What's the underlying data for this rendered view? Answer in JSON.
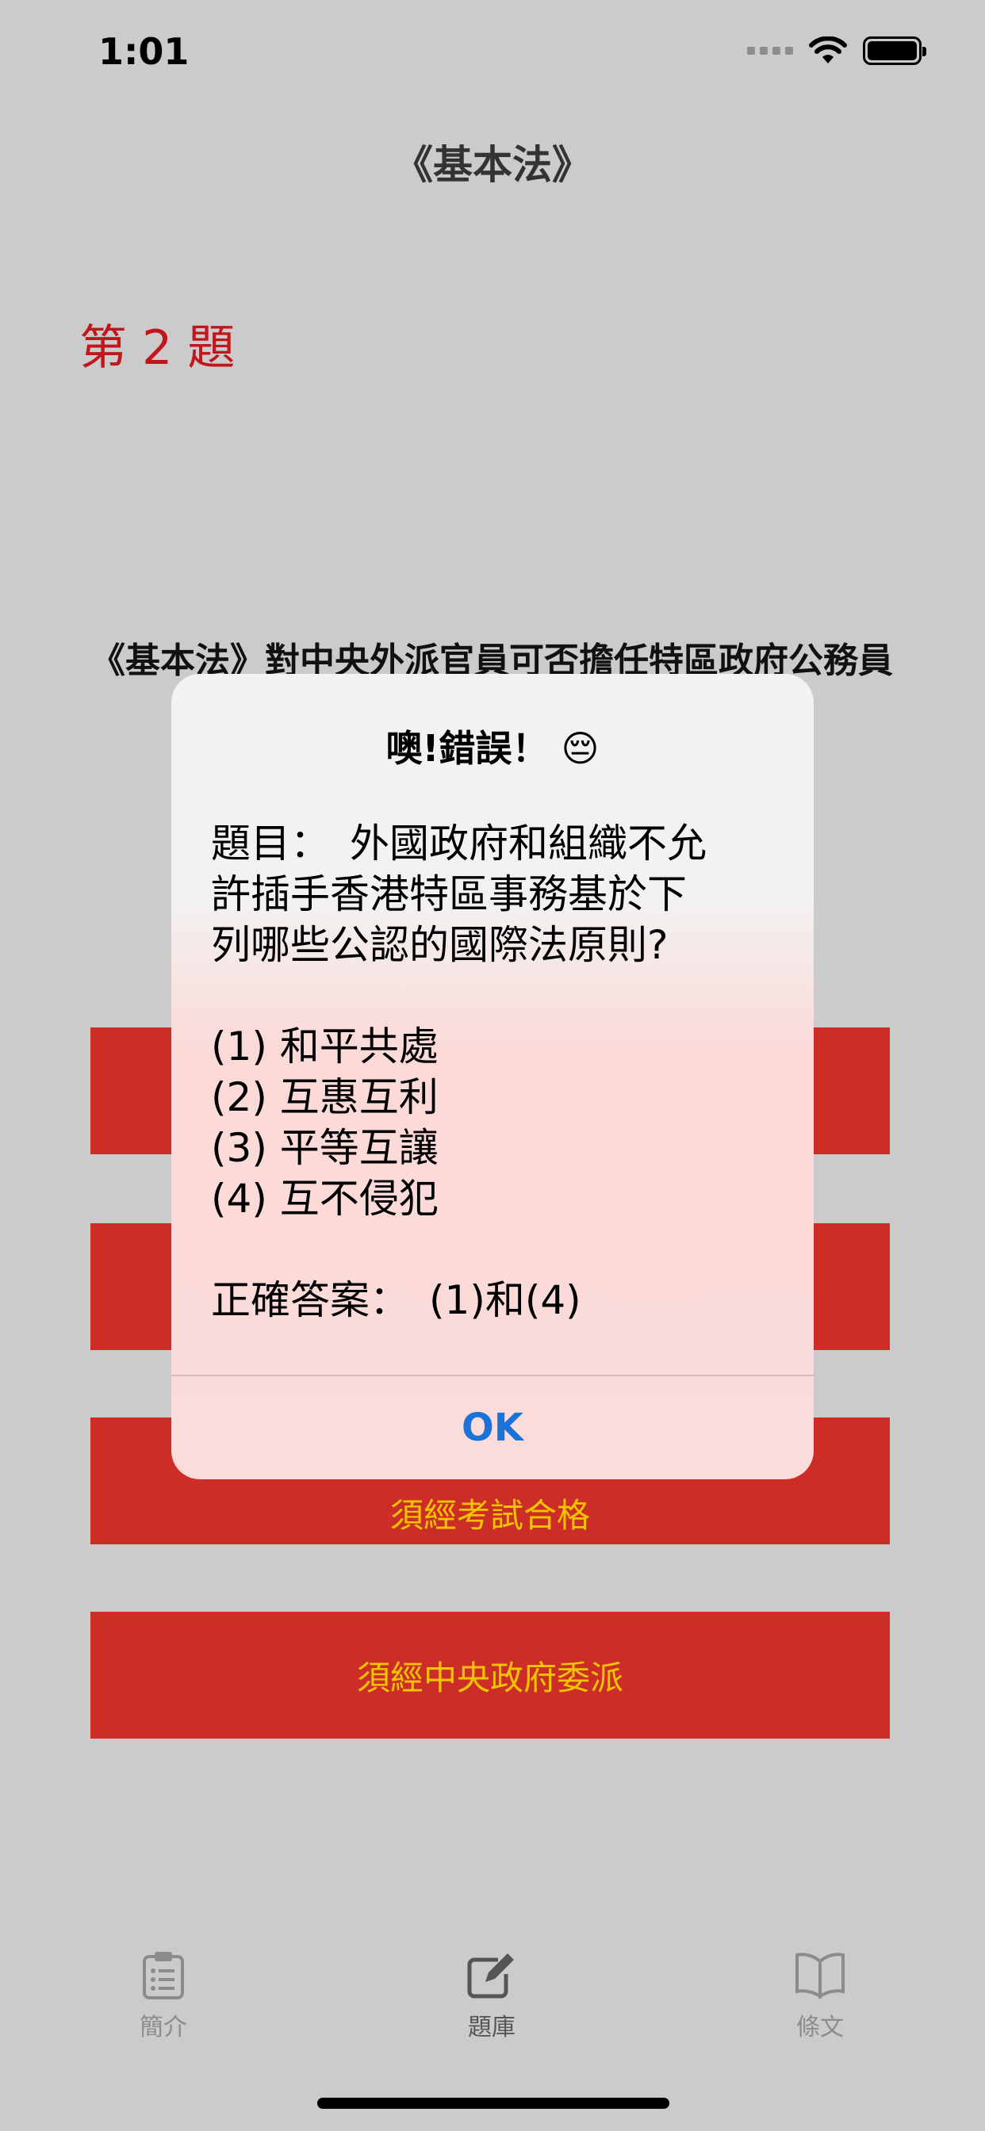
{
  "status_bar": {
    "time": "1:01"
  },
  "nav": {
    "title": "《基本法》"
  },
  "question": {
    "number_label": "第 2 題",
    "text": "《基本法》對中央外派官員可否擔任特區政府公務員"
  },
  "answers": [
    {
      "label": ""
    },
    {
      "label": ""
    },
    {
      "label": "須經考試合格"
    },
    {
      "label": "須經中央政府委派"
    }
  ],
  "alert": {
    "title": "噢!錯誤！ 😔",
    "question_lines": [
      "題目：　外國政府和組織不允",
      "許插手香港特區事務基於下",
      "列哪些公認的國際法原則?"
    ],
    "options": [
      "(1) 和平共處",
      "(2) 互惠互利",
      "(3) 平等互讓",
      "(4) 互不侵犯"
    ],
    "correct_answer": "正確答案：　(1)和(4)",
    "ok_label": "OK"
  },
  "tabs": [
    {
      "label": "簡介",
      "icon": "clipboard-icon",
      "active": false
    },
    {
      "label": "題庫",
      "icon": "edit-icon",
      "active": true
    },
    {
      "label": "條文",
      "icon": "book-icon",
      "active": false
    }
  ],
  "colors": {
    "answer_bg": "#cd2d27",
    "answer_text": "#f2c400",
    "question_number": "#c3161c",
    "ok_link": "#1a73d9"
  }
}
